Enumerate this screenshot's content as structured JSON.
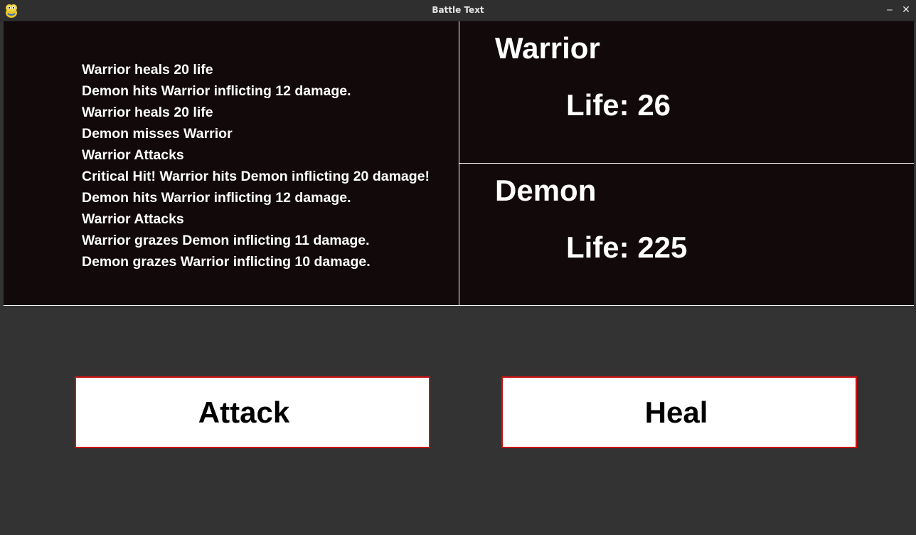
{
  "window": {
    "title": "Battle Text",
    "icon": "pygame-snake-icon",
    "minimize_glyph": "‒",
    "close_glyph": "✕"
  },
  "battle_log": [
    "Warrior heals 20 life",
    "Demon hits Warrior inflicting 12 damage.",
    "Warrior heals 20 life",
    "Demon misses Warrior",
    "Warrior Attacks",
    "Critical Hit! Warrior hits Demon inflicting 20 damage!",
    "Demon hits Warrior inflicting 12 damage.",
    "Warrior Attacks",
    "Warrior grazes Demon inflicting 11 damage.",
    "Demon grazes Warrior inflicting 10 damage."
  ],
  "warrior": {
    "name": "Warrior",
    "life_text": "Life: 26"
  },
  "demon": {
    "name": "Demon",
    "life_text": "Life: 225"
  },
  "actions": {
    "attack_label": "Attack",
    "heal_label": "Heal"
  },
  "colors": {
    "background": "#333333",
    "panel": "#120a0a",
    "text": "#ffffff",
    "button_fill": "#ffffff",
    "button_border": "#cc1111"
  }
}
